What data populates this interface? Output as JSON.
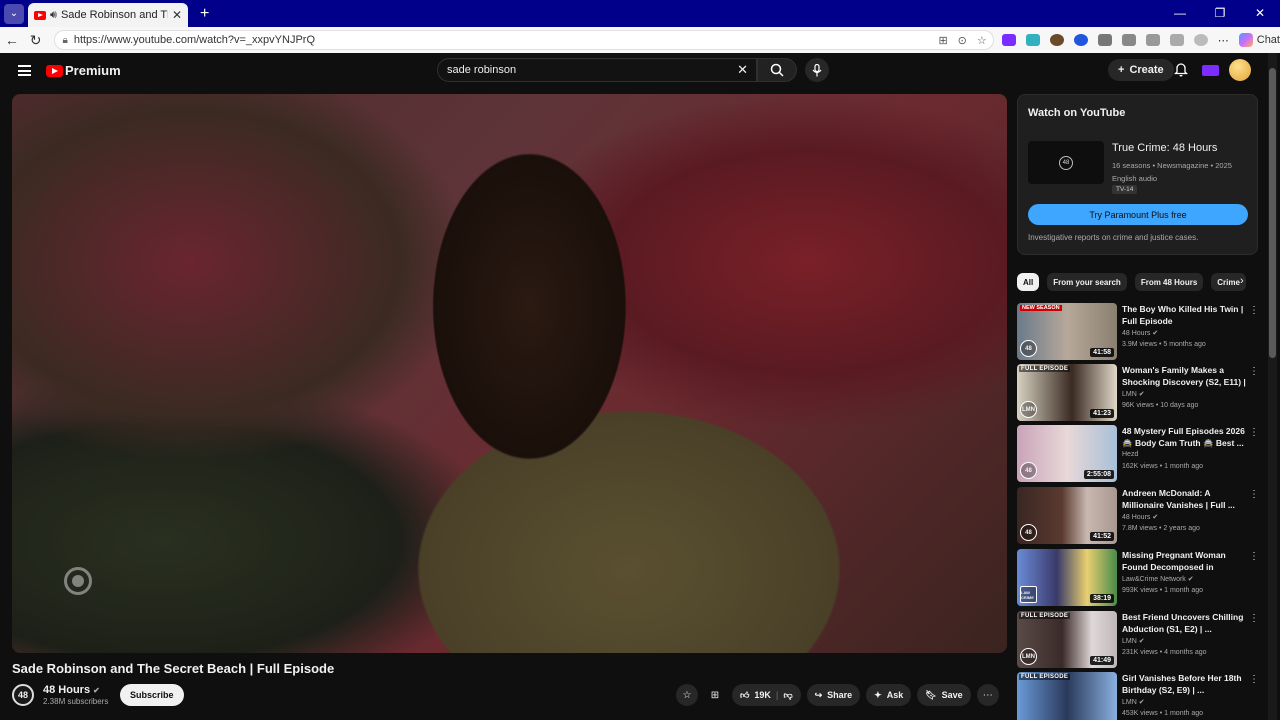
{
  "browser": {
    "tab_title": "Sade Robinson and The Secret",
    "url": "https://www.youtube.com/watch?v=_xxpvYNJPrQ",
    "chat_label": "Chat"
  },
  "header": {
    "logo_text": "Premium",
    "search_value": "sade robinson",
    "create_label": "Create"
  },
  "video": {
    "title": "Sade Robinson and The Secret Beach | Full Episode",
    "channel": "48 Hours",
    "channel_logo": "48",
    "subscribers": "2.38M subscribers",
    "subscribe_label": "Subscribe",
    "likes": "19K",
    "share_label": "Share",
    "ask_label": "Ask",
    "save_label": "Save"
  },
  "watch_card": {
    "heading": "Watch on YouTube",
    "show_title": "True Crime: 48 Hours",
    "meta_line1": "16 seasons • Newsmagazine • 2025",
    "meta_line2": "English audio",
    "rating": "TV-14",
    "cta": "Try Paramount Plus free",
    "description": "Investigative reports on crime and justice cases."
  },
  "chips": [
    "All",
    "From your search",
    "From 48 Hours",
    "Crime"
  ],
  "recommendations": [
    {
      "title": "The Boy Who Killed His Twin | Full Episode",
      "channel": "48 Hours",
      "views": "3.9M views • 5 months ago",
      "duration": "41:58",
      "badge": "NEW SEASON",
      "logo": "48",
      "colors": [
        "#6a7a8a",
        "#b7a89a"
      ]
    },
    {
      "title": "Woman's Family Makes a Shocking Discovery (S2, E11) | ...",
      "channel": "LMN",
      "views": "96K views • 10 days ago",
      "duration": "41:23",
      "badge": "FULL EPISODE",
      "logo": "LMN",
      "colors": [
        "#d8d2c2",
        "#3a2a22"
      ]
    },
    {
      "title": "48 Mystery Full Episodes 2026 🚔 Body Cam Truth 🚔 Best ...",
      "channel": "Hezd",
      "views": "162K views • 1 month ago",
      "duration": "2:55:08",
      "badge": "",
      "logo": "48",
      "colors": [
        "#c9a3b8",
        "#e8d8d8"
      ]
    },
    {
      "title": "Andreen McDonald: A Millionaire Vanishes | Full ...",
      "channel": "48 Hours",
      "views": "7.8M views • 2 years ago",
      "duration": "41:52",
      "badge": "",
      "logo": "48",
      "colors": [
        "#3a2622",
        "#c8b8b0"
      ]
    },
    {
      "title": "Missing Pregnant Woman Found Decomposed in Maryla...",
      "channel": "Law&Crime Network",
      "views": "993K views • 1 month ago",
      "duration": "38:19",
      "badge": "",
      "logo": "LAW CRIME",
      "colors": [
        "#6b8bd8",
        "#e8d070"
      ]
    },
    {
      "title": "Best Friend Uncovers Chilling Abduction (S1, E2) | ...",
      "channel": "LMN",
      "views": "231K views • 4 months ago",
      "duration": "41:49",
      "badge": "FULL EPISODE",
      "logo": "LMN",
      "colors": [
        "#5a4a48",
        "#e0d8d8"
      ]
    },
    {
      "title": "Girl Vanishes Before Her 18th Birthday (S2, E9) | ...",
      "channel": "LMN",
      "views": "453K views • 1 month ago",
      "duration": "",
      "badge": "FULL EPISODE",
      "logo": "LMN",
      "colors": [
        "#6a9ad8",
        "#2a3a5a"
      ]
    }
  ]
}
